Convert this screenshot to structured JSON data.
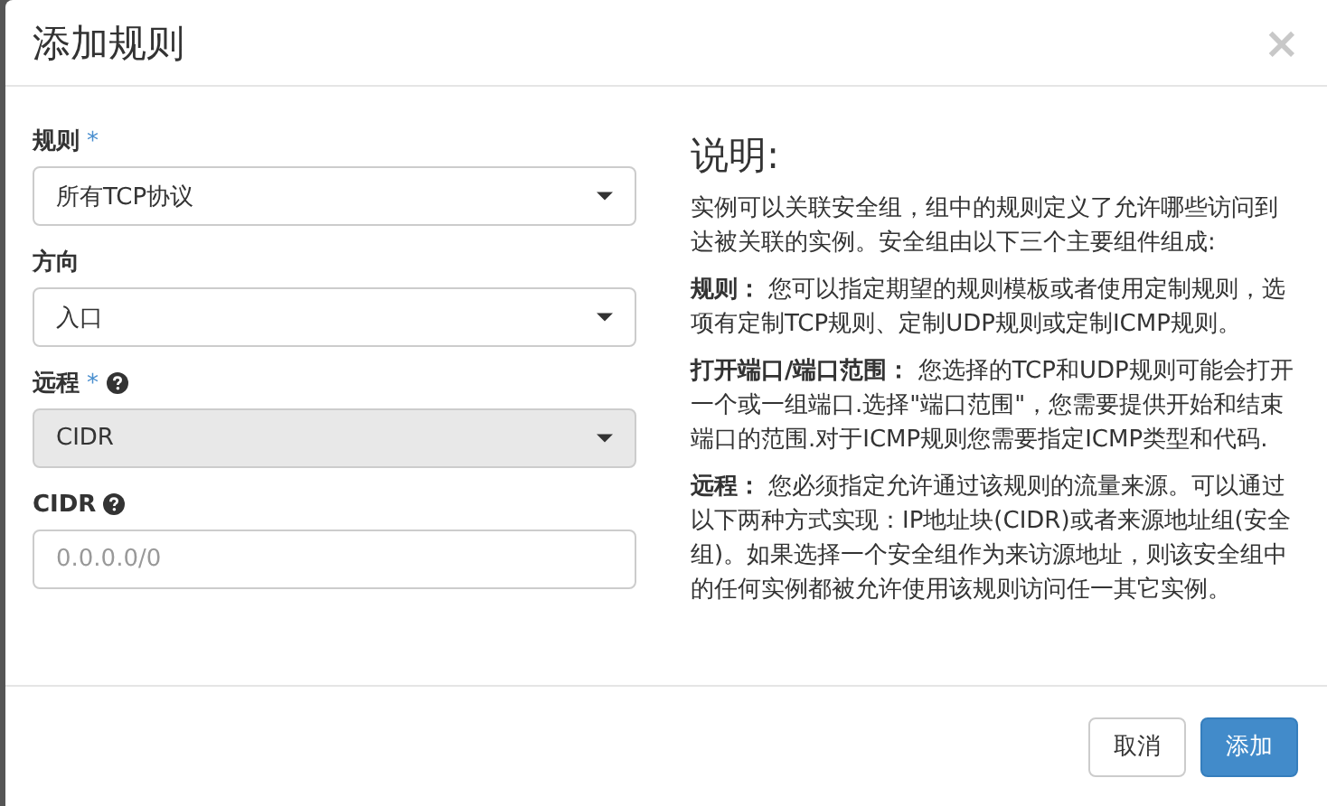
{
  "dialog": {
    "title": "添加规则",
    "close": "×"
  },
  "fields": [
    {
      "kind": "select",
      "label": "规则",
      "required_mark": "*",
      "help": false,
      "value": "所有TCP协议",
      "disabled": false
    },
    {
      "kind": "select",
      "label": "方向",
      "help": false,
      "value": "入口",
      "disabled": false
    },
    {
      "kind": "select",
      "label": "远程",
      "required_mark": "*",
      "help": true,
      "value": "CIDR",
      "disabled": true
    },
    {
      "kind": "input",
      "label": "CIDR",
      "help": true,
      "placeholder": "0.0.0.0/0",
      "disabled": false
    }
  ],
  "help_panel": {
    "heading": "说明:",
    "paragraphs": [
      "实例可以关联安全组，组中的规则定义了允许哪些访问到达被关联的实例。安全组由以下三个主要组件组成:",
      "**规则：** 您可以指定期望的规则模板或者使用定制规则，选项有定制TCP规则、定制UDP规则或定制ICMP规则。",
      "**打开端口/端口范围：** 您选择的TCP和UDP规则可能会打开一个或一组端口.选择\"端口范围\"，您需要提供开始和结束端口的范围.对于ICMP规则您需要指定ICMP类型和代码.",
      "**远程：** 您必须指定允许通过该规则的流量来源。可以通过以下两种方式实现：IP地址块(CIDR)或者来源地址组(安全组)。如果选择一个安全组作为来访源地址，则该安全组中的任何实例都被允许使用该规则访问任一其它实例。"
    ]
  },
  "buttons": [
    {
      "kind": "default",
      "label": "取消"
    },
    {
      "kind": "primary",
      "label": "添加"
    }
  ]
}
